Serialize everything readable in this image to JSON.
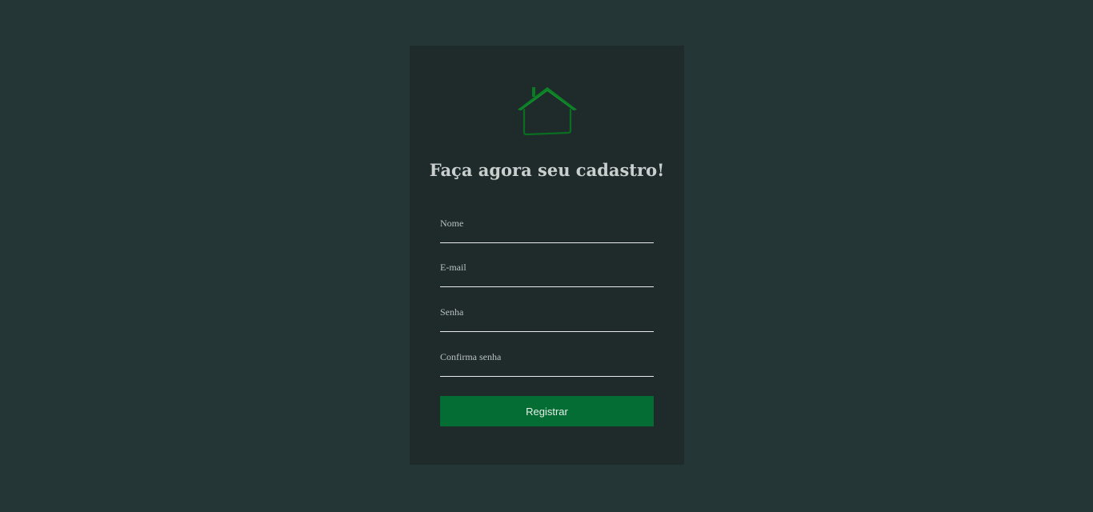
{
  "form": {
    "title": "Faça agora seu cadastro!",
    "fields": [
      {
        "label": "Nome",
        "value": "",
        "placeholder": ""
      },
      {
        "label": "E-mail",
        "value": "",
        "placeholder": ""
      },
      {
        "label": "Senha",
        "value": "",
        "placeholder": ""
      },
      {
        "label": "Confirma senha",
        "value": "",
        "placeholder": ""
      }
    ],
    "submit_label": "Registrar"
  },
  "logo": {
    "icon": "house-icon",
    "color": "#0f8a2a"
  },
  "colors": {
    "page_background": "#243636",
    "card_background": "#1f2b2b",
    "button_background": "#046d33"
  }
}
